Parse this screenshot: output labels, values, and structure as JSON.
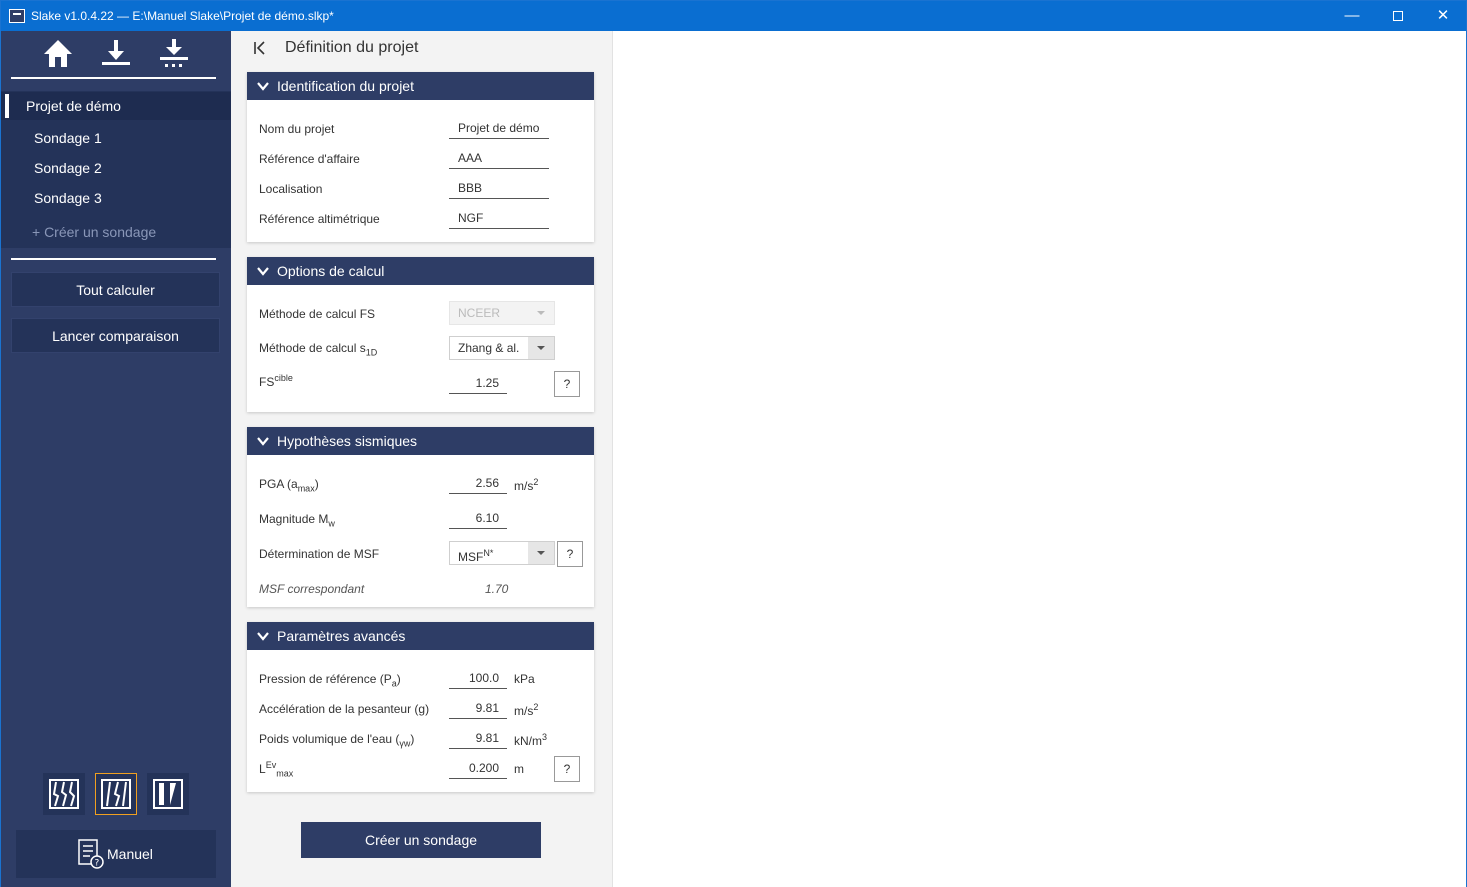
{
  "window": {
    "title": "Slake v1.0.4.22 — E:\\Manuel Slake\\Projet de démo.slkp*",
    "minimize_glyph": "—",
    "close_glyph": "✕"
  },
  "sidebar": {
    "top_icons": [
      "home-icon",
      "download-icon",
      "download-grid-icon"
    ],
    "nav": {
      "project": "Projet de démo",
      "soundings": [
        "Sondage 1",
        "Sondage 2",
        "Sondage 3"
      ],
      "create": "+ Créer un sondage"
    },
    "compute_all": "Tout calculer",
    "compare": "Lancer comparaison",
    "modes": [
      "mode-1-icon",
      "mode-2-icon",
      "mode-3-icon"
    ],
    "manual": "Manuel"
  },
  "content": {
    "page_title": "Définition du projet",
    "identification": {
      "header": "Identification du projet",
      "rows": [
        {
          "label": "Nom du projet",
          "value": "Projet de démo"
        },
        {
          "label": "Référence d'affaire",
          "value": "AAA"
        },
        {
          "label": "Localisation",
          "value": "BBB"
        },
        {
          "label": "Référence altimétrique",
          "value": "NGF"
        }
      ]
    },
    "options": {
      "header": "Options de calcul",
      "fs_method_label": "Méthode de calcul FS",
      "fs_method_value": "NCEER",
      "s1d_method_label": "Méthode de calcul s",
      "s1d_method_sub": "1D",
      "s1d_method_value": "Zhang & al.",
      "fs_target_label": "FS",
      "fs_target_sup": "cible",
      "fs_target_value": "1.25",
      "help": "?"
    },
    "seismic": {
      "header": "Hypothèses sismiques",
      "pga_label": "PGA (a",
      "pga_sub": "max",
      "pga_close": ")",
      "pga_value": "2.56",
      "pga_unit": "m/s",
      "pga_unit_sup": "2",
      "mag_label": "Magnitude M",
      "mag_sub": "w",
      "mag_value": "6.10",
      "msf_label": "Détermination de MSF",
      "msf_value": "MSF",
      "msf_sup": "N*",
      "msf_corr_label": "MSF correspondant",
      "msf_corr_value": "1.70",
      "help": "?"
    },
    "advanced": {
      "header": "Paramètres avancés",
      "pa_label": "Pression de référence (P",
      "pa_sub": "a",
      "pa_close": ")",
      "pa_value": "100.0",
      "pa_unit": "kPa",
      "g_label": "Accélération de la pesanteur (g)",
      "g_value": "9.81",
      "g_unit": "m/s",
      "g_unit_sup": "2",
      "gw_label": "Poids volumique de l'eau (",
      "gw_sub": "γw",
      "gw_close": ")",
      "gw_value": "9.81",
      "gw_unit": "kN/m",
      "gw_unit_sup": "3",
      "lev_label": "L",
      "lev_sup": "Ev",
      "lev_sub": "max",
      "lev_value": "0.200",
      "lev_unit": "m",
      "help": "?"
    },
    "create_button": "Créer un sondage"
  }
}
